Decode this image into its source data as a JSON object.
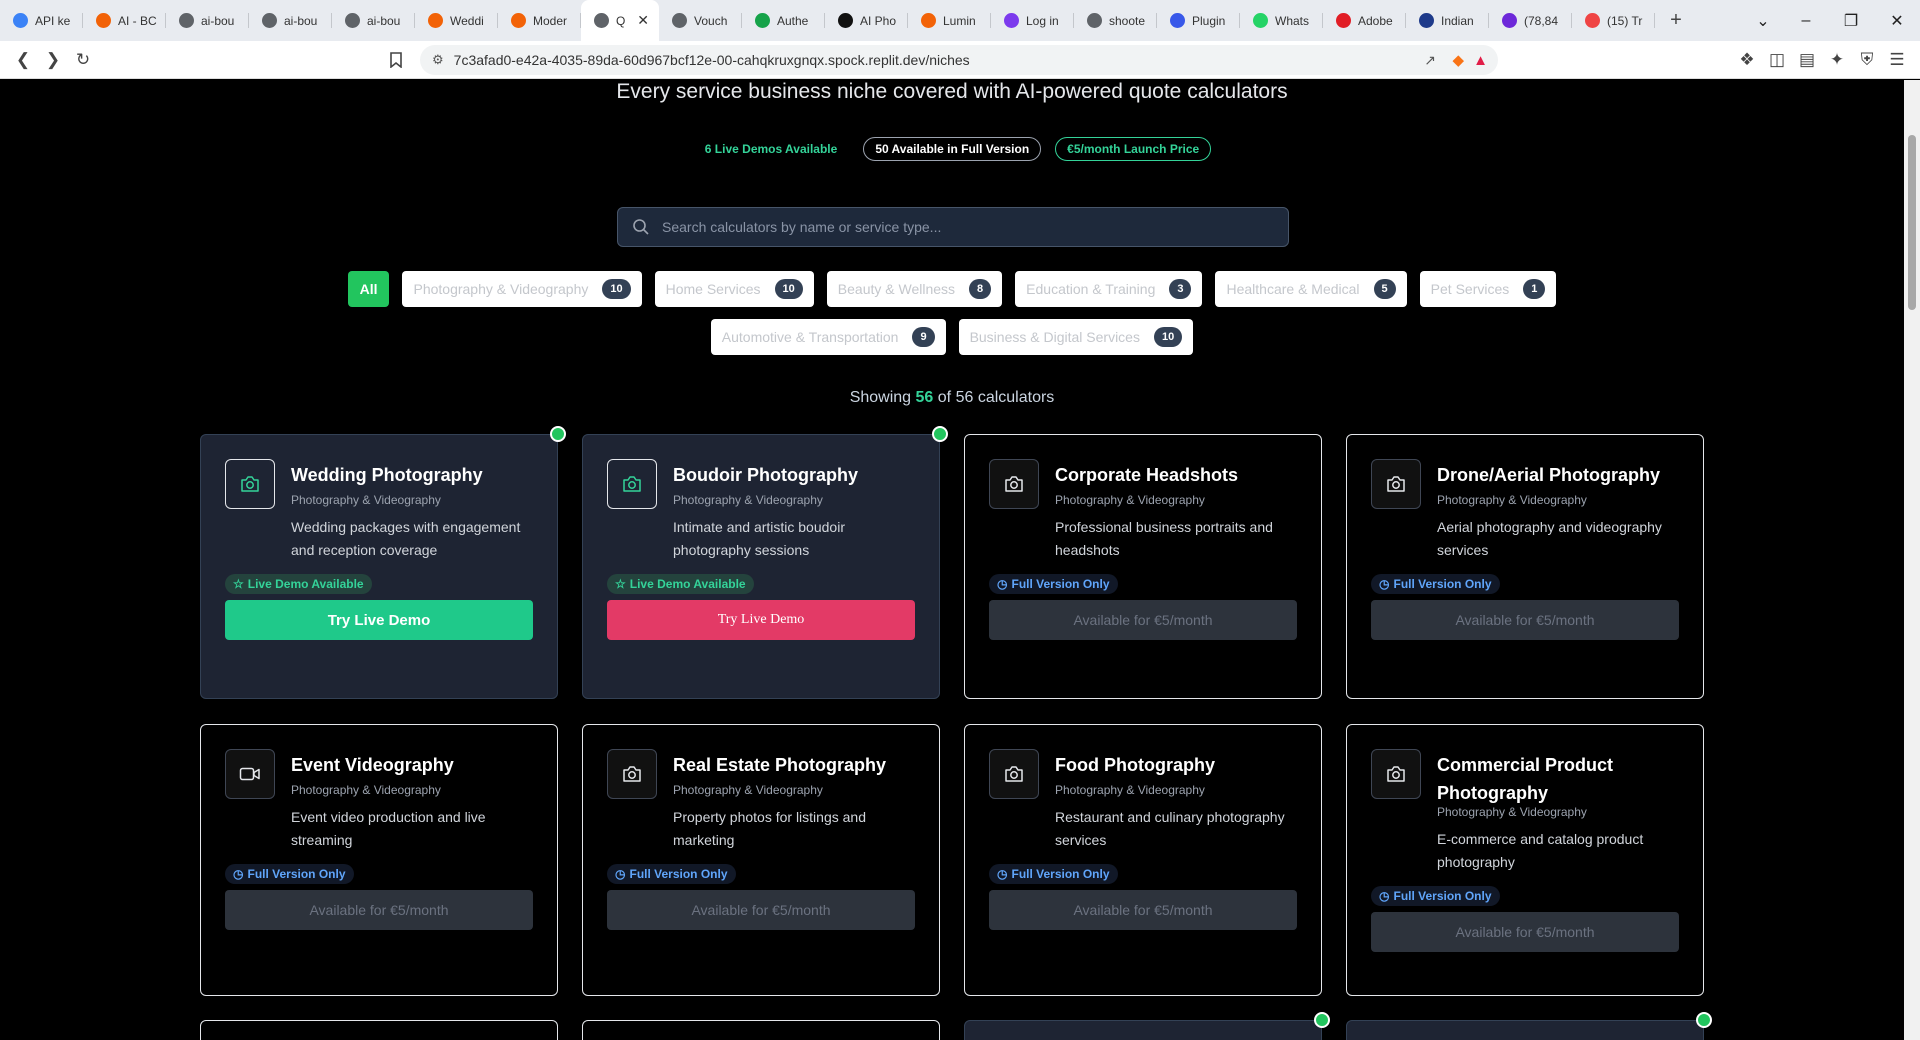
{
  "browser": {
    "tabs": [
      {
        "label": "API ke",
        "icon": "globe-icon",
        "color": "#3b82f6"
      },
      {
        "label": "AI - BC",
        "icon": "replit-icon",
        "color": "#f26207"
      },
      {
        "label": "ai-bou",
        "icon": "globe-icon",
        "color": "#5f6368"
      },
      {
        "label": "ai-bou",
        "icon": "globe-icon",
        "color": "#5f6368"
      },
      {
        "label": "ai-bou",
        "icon": "globe-icon",
        "color": "#5f6368"
      },
      {
        "label": "Weddi",
        "icon": "replit-icon",
        "color": "#f26207"
      },
      {
        "label": "Moder",
        "icon": "replit-icon",
        "color": "#f26207"
      },
      {
        "label": "Q",
        "icon": "globe-icon",
        "color": "#5f6368",
        "active": true
      },
      {
        "label": "Vouch",
        "icon": "globe-icon",
        "color": "#5f6368"
      },
      {
        "label": "Authe",
        "icon": "authenticator-icon",
        "color": "#16a34a"
      },
      {
        "label": "AI Pho",
        "icon": "openai-icon",
        "color": "#111"
      },
      {
        "label": "Lumin",
        "icon": "replit-icon",
        "color": "#f26207"
      },
      {
        "label": "Log in",
        "icon": "pen-icon",
        "color": "#7c3aed"
      },
      {
        "label": "shoote",
        "icon": "globe-icon",
        "color": "#5f6368"
      },
      {
        "label": "Plugin",
        "icon": "wordpress-icon",
        "color": "#3858e9"
      },
      {
        "label": "Whats",
        "icon": "whatsapp-icon",
        "color": "#25d366"
      },
      {
        "label": "Adobe",
        "icon": "adobe-icon",
        "color": "#e11d25"
      },
      {
        "label": "Indian",
        "icon": "news-icon",
        "color": "#1e3a8a"
      },
      {
        "label": "(78,84",
        "icon": "yahoo-mail-icon",
        "color": "#6d28d9"
      },
      {
        "label": "(15) Tr",
        "icon": "youtube-icon",
        "color": "#ef4444"
      }
    ],
    "url": "7c3afad0-e42a-4035-89da-60d967bcf12e-00-cahqkruxgnqx.spock.replit.dev/niches"
  },
  "hero": {
    "subtitle": "Every service business niche covered with AI-powered quote calculators",
    "badges": [
      "6 Live Demos Available",
      "50 Available in Full Version",
      "€5/month Launch Price"
    ]
  },
  "search": {
    "placeholder": "Search calculators by name or service type..."
  },
  "filters": {
    "all": "All",
    "row1": [
      {
        "label": "Photography & Videography",
        "count": "10"
      },
      {
        "label": "Home Services",
        "count": "10"
      },
      {
        "label": "Beauty & Wellness",
        "count": "8"
      },
      {
        "label": "Education & Training",
        "count": "3"
      },
      {
        "label": "Healthcare & Medical",
        "count": "5"
      },
      {
        "label": "Pet Services",
        "count": "1"
      }
    ],
    "row2": [
      {
        "label": "Automotive & Transportation",
        "count": "9"
      },
      {
        "label": "Business & Digital Services",
        "count": "10"
      }
    ]
  },
  "showing": {
    "prefix": "Showing",
    "shown": "56",
    "middle": "of 56 calculators"
  },
  "cards": [
    {
      "title": "Wedding Photography",
      "category": "Photography & Videography",
      "desc": "Wedding packages with engagement and reception coverage",
      "status": "Live Demo Available",
      "action": "Try Live Demo",
      "live": true,
      "style": "green",
      "icon": "camera-icon"
    },
    {
      "title": "Boudoir Photography",
      "category": "Photography & Videography",
      "desc": "Intimate and artistic boudoir photography sessions",
      "status": "Live Demo Available",
      "action": "Try Live Demo",
      "live": true,
      "style": "pink",
      "icon": "camera-icon"
    },
    {
      "title": "Corporate Headshots",
      "category": "Photography & Videography",
      "desc": "Professional business portraits and headshots",
      "status": "Full Version Only",
      "action": "Available for €5/month",
      "live": false,
      "icon": "camera-icon"
    },
    {
      "title": "Drone/Aerial Photography",
      "category": "Photography & Videography",
      "desc": "Aerial photography and videography services",
      "status": "Full Version Only",
      "action": "Available for €5/month",
      "live": false,
      "icon": "camera-icon"
    },
    {
      "title": "Event Videography",
      "category": "Photography & Videography",
      "desc": "Event video production and live streaming",
      "status": "Full Version Only",
      "action": "Available for €5/month",
      "live": false,
      "icon": "video-icon"
    },
    {
      "title": "Real Estate Photography",
      "category": "Photography & Videography",
      "desc": "Property photos for listings and marketing",
      "status": "Full Version Only",
      "action": "Available for €5/month",
      "live": false,
      "icon": "camera-icon"
    },
    {
      "title": "Food Photography",
      "category": "Photography & Videography",
      "desc": "Restaurant and culinary photography services",
      "status": "Full Version Only",
      "action": "Available for €5/month",
      "live": false,
      "icon": "camera-icon"
    },
    {
      "title": "Commercial Product Photography",
      "category": "Photography & Videography",
      "desc": "E-commerce and catalog product photography",
      "status": "Full Version Only",
      "action": "Available for €5/month",
      "live": false,
      "icon": "camera-icon"
    }
  ]
}
